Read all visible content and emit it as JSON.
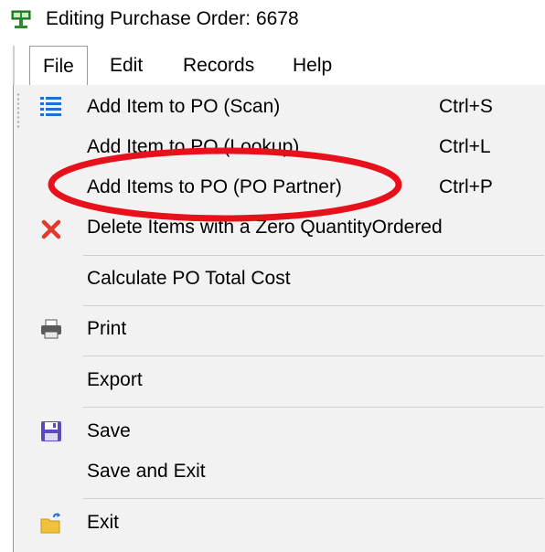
{
  "window": {
    "title": "Editing Purchase Order:  6678",
    "app_icon": "cash-register-icon"
  },
  "menubar": {
    "items": [
      {
        "label": "File",
        "active": true
      },
      {
        "label": "Edit",
        "active": false
      },
      {
        "label": "Records",
        "active": false
      },
      {
        "label": "Help",
        "active": false
      }
    ]
  },
  "file_menu": {
    "items": [
      {
        "label": "Add Item to PO (Scan)",
        "shortcut": "Ctrl+S",
        "icon": "list-icon"
      },
      {
        "label": "Add Item to PO (Lookup)",
        "shortcut": "Ctrl+L",
        "icon": ""
      },
      {
        "label": "Add Items to PO (PO Partner)",
        "shortcut": "Ctrl+P",
        "icon": ""
      },
      {
        "label": "Delete Items with a Zero QuantityOrdered",
        "shortcut": "",
        "icon": "red-x-icon"
      },
      {
        "label": "Calculate PO Total Cost",
        "shortcut": "",
        "icon": ""
      },
      {
        "label": "Print",
        "shortcut": "",
        "icon": "printer-icon"
      },
      {
        "label": "Export",
        "shortcut": "",
        "icon": ""
      },
      {
        "label": "Save",
        "shortcut": "",
        "icon": "floppy-disk-icon"
      },
      {
        "label": "Save and Exit",
        "shortcut": "",
        "icon": ""
      },
      {
        "label": "Exit",
        "shortcut": "",
        "icon": "folder-exit-icon"
      }
    ]
  },
  "annotation": {
    "type": "red-ellipse-highlight",
    "color": "#e8101a",
    "target": "Add Items to PO (PO Partner)"
  }
}
